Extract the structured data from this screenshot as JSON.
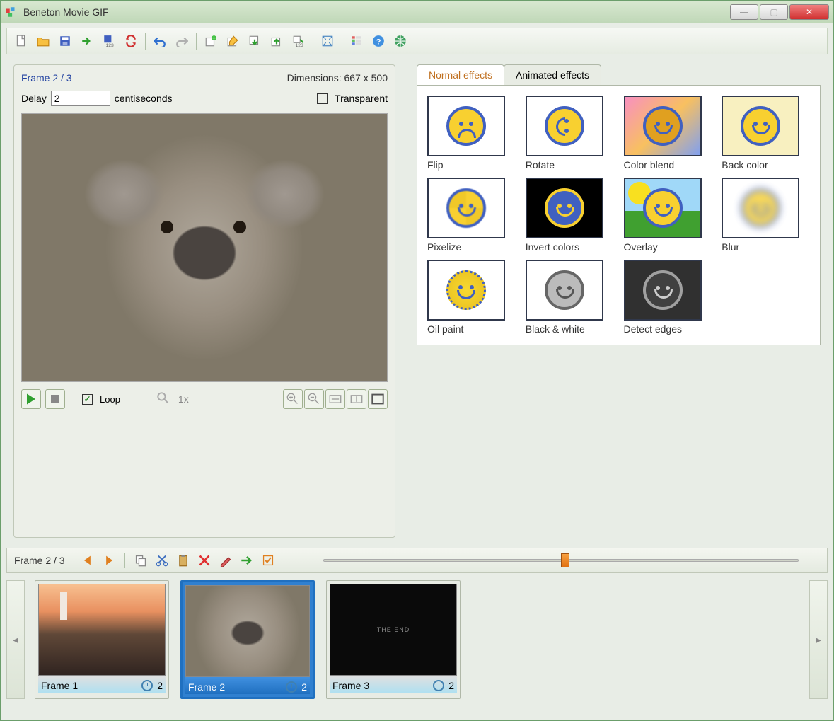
{
  "window": {
    "title": "Beneton Movie GIF"
  },
  "toolbar": {
    "groups": [
      [
        "new",
        "open",
        "save",
        "insert-arrow",
        "save-frames",
        "loop-toggle"
      ],
      [
        "undo",
        "redo"
      ],
      [
        "add-frame",
        "dup-frame",
        "export-frame",
        "import-frame",
        "renumber"
      ],
      [
        "fit"
      ],
      [
        "properties",
        "help",
        "web"
      ]
    ]
  },
  "preview": {
    "frame_label": "Frame 2 / 3",
    "dimensions": "Dimensions: 667 x 500",
    "delay_label": "Delay",
    "delay_value": "2",
    "delay_unit": "centiseconds",
    "transparent_label": "Transparent",
    "transparent_checked": false,
    "loop_label": "Loop",
    "loop_checked": true,
    "zoom_label": "1x"
  },
  "effects": {
    "tabs": [
      "Normal effects",
      "Animated effects"
    ],
    "active_tab": 0,
    "items": [
      {
        "id": "flip",
        "label": "Flip"
      },
      {
        "id": "rotate",
        "label": "Rotate"
      },
      {
        "id": "colorblend",
        "label": "Color blend"
      },
      {
        "id": "backcolor",
        "label": "Back color"
      },
      {
        "id": "pixelize",
        "label": "Pixelize"
      },
      {
        "id": "invert",
        "label": "Invert colors"
      },
      {
        "id": "overlay",
        "label": "Overlay"
      },
      {
        "id": "blur",
        "label": "Blur"
      },
      {
        "id": "oilpaint",
        "label": "Oil paint"
      },
      {
        "id": "bw",
        "label": "Black & white"
      },
      {
        "id": "detect",
        "label": "Detect edges"
      }
    ]
  },
  "timeline": {
    "label": "Frame 2 / 3",
    "frames": [
      {
        "name": "Frame 1",
        "delay": "2",
        "thumb": "lighthouse",
        "selected": false
      },
      {
        "name": "Frame 2",
        "delay": "2",
        "thumb": "koala",
        "selected": true
      },
      {
        "name": "Frame 3",
        "delay": "2",
        "thumb": "black",
        "selected": false,
        "text": "THE END"
      }
    ]
  }
}
